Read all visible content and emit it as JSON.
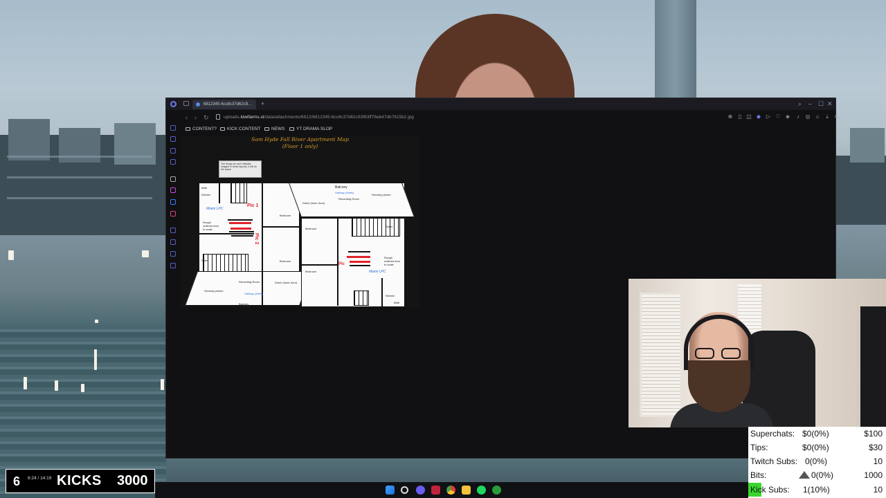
{
  "browser": {
    "tab_title": "6812345-6cc8c37d62c9...",
    "url_prefix": "uploads.",
    "url_domain": "kiwifarms.st",
    "url_path": "/data/attachments/6812/6812345-6cc8c37d62c93f63ff76eb47db7615b2.jpg",
    "bookmarks": [
      "CONTENT?",
      "KICK CONTENT",
      "NEWS",
      "YT DRAMA SLOP"
    ]
  },
  "map": {
    "title_line1": "Sam Hyde Fall River Apartment Map",
    "title_line2": "(Floor 1 only)",
    "note": "The things we can't officially imagine in these layouts, it will do the space",
    "labels": {
      "balcony_top": "Balcony",
      "balcony_bottom": "Balcony",
      "bedroom_1": "Bedroom",
      "bedroom_2": "Bedroom",
      "bedroom_3": "Bedroom",
      "bedroom_4": "Bedroom",
      "recording_room_top": "Recording Room",
      "recording_room_bottom": "Recording Room",
      "kitchen_left": "Kitchen",
      "kitchen_right": "Kitchen",
      "stairs_left": "Stairs",
      "stairs_right": "Stairs",
      "bath_left": "Bath",
      "bath_right": "Bath",
      "miami_left": "Miami LPC",
      "miami_right": "Miami LPC",
      "hallway_top": "Hallway (Inlets)",
      "hallway_bottom": "Hallway (Inlets)",
      "dutch_door_top": "Dutch (inner door)",
      "dutch_door_bottom": "Dutch (inner door)",
      "rough_sketch_left": "Rough outlined door to scale",
      "rough_sketch_right": "Rough outlined door to scale",
      "security_top": "Security picture",
      "security_bottom": "Security picture",
      "pic1": "Pic 1",
      "pic2": "Pic 2",
      "pic3": "Pic"
    }
  },
  "stats": {
    "superchats_label": "Superchats:",
    "superchats_value": "$0(0%)",
    "superchats_goal": "$100",
    "tips_label": "Tips:",
    "tips_value": "$0(0%)",
    "tips_goal": "$30",
    "twitch_label": "Twitch Subs:",
    "twitch_value": "0(0%)",
    "twitch_goal": "10",
    "bits_label": "Bits:",
    "bits_value": "0(0%)",
    "bits_goal": "1000",
    "kick_label": "Kick Subs:",
    "kick_value": "1(10%)",
    "kick_goal": "10"
  },
  "kicks": {
    "count": "6",
    "time": "6:24 / 14:19",
    "label": "KICKS",
    "goal": "3000"
  },
  "colors": {
    "kick_green": "#39d72c",
    "map_title": "#d99a2c",
    "accent_blue": "#5b86e5"
  }
}
